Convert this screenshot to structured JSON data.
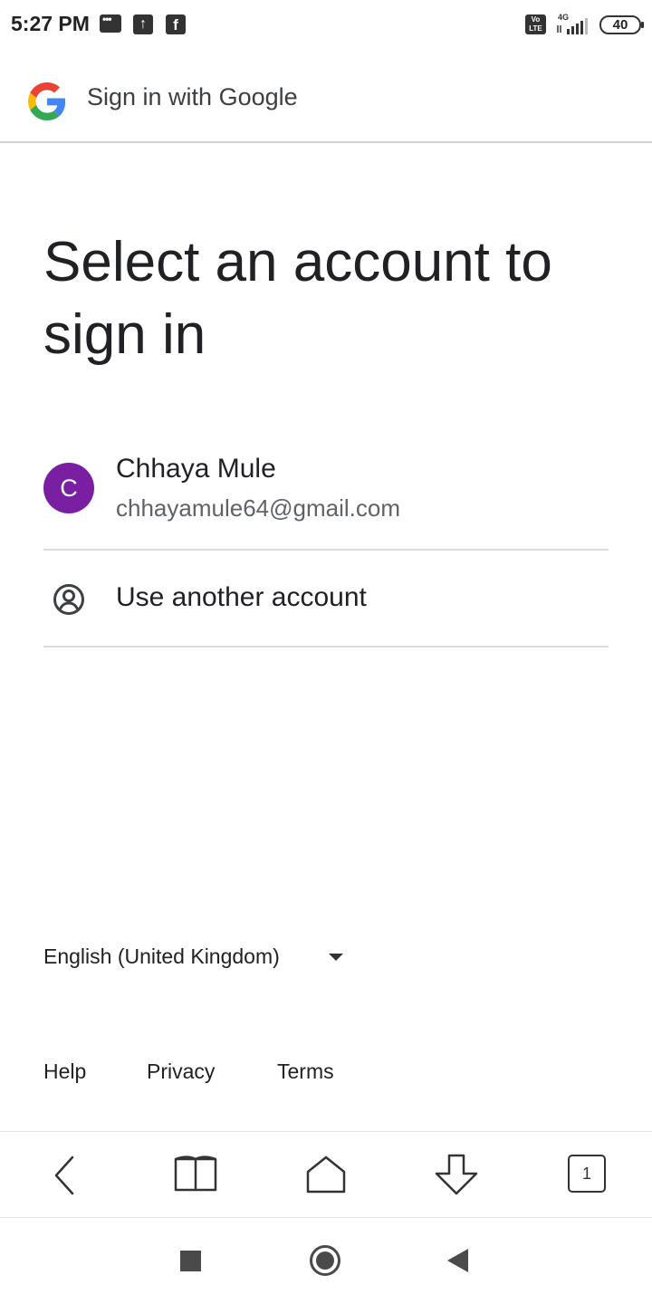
{
  "status_bar": {
    "time": "5:27 PM",
    "network": "4G",
    "volte": "Vo LTE",
    "battery": "40",
    "icons": [
      "message-icon",
      "upload-icon",
      "facebook-icon",
      "volte-icon",
      "signal-icon",
      "battery-icon"
    ]
  },
  "header": {
    "title": "Sign in with Google",
    "logo": "google-g-logo"
  },
  "main": {
    "title": "Select an account to sign in",
    "account": {
      "avatar_letter": "C",
      "avatar_color": "#7b1fa2",
      "name": "Chhaya Mule",
      "email": "chhayamule64@gmail.com"
    },
    "use_another": {
      "label": "Use another account",
      "icon": "person-circle-icon"
    }
  },
  "language": {
    "selected": "English (United Kingdom)"
  },
  "footer": {
    "help": "Help",
    "privacy": "Privacy",
    "terms": "Terms"
  },
  "browser_toolbar": {
    "tab_count": "1",
    "icons": [
      "back-icon",
      "bookmarks-icon",
      "home-icon",
      "download-icon",
      "tabs-icon"
    ]
  },
  "nav_bar": {
    "icons": [
      "recent-apps-icon",
      "home-circle-icon",
      "back-triangle-icon"
    ]
  }
}
